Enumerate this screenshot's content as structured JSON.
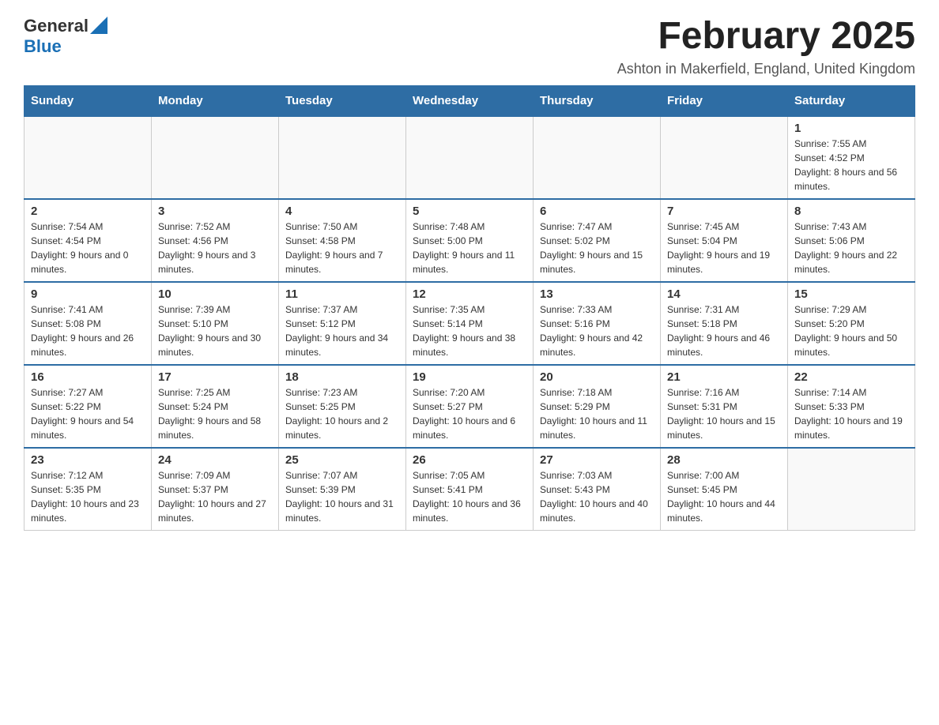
{
  "header": {
    "title": "February 2025",
    "subtitle": "Ashton in Makerfield, England, United Kingdom",
    "logo_general": "General",
    "logo_blue": "Blue"
  },
  "days_of_week": [
    "Sunday",
    "Monday",
    "Tuesday",
    "Wednesday",
    "Thursday",
    "Friday",
    "Saturday"
  ],
  "weeks": [
    [
      {
        "day": "",
        "info": ""
      },
      {
        "day": "",
        "info": ""
      },
      {
        "day": "",
        "info": ""
      },
      {
        "day": "",
        "info": ""
      },
      {
        "day": "",
        "info": ""
      },
      {
        "day": "",
        "info": ""
      },
      {
        "day": "1",
        "info": "Sunrise: 7:55 AM\nSunset: 4:52 PM\nDaylight: 8 hours and 56 minutes."
      }
    ],
    [
      {
        "day": "2",
        "info": "Sunrise: 7:54 AM\nSunset: 4:54 PM\nDaylight: 9 hours and 0 minutes."
      },
      {
        "day": "3",
        "info": "Sunrise: 7:52 AM\nSunset: 4:56 PM\nDaylight: 9 hours and 3 minutes."
      },
      {
        "day": "4",
        "info": "Sunrise: 7:50 AM\nSunset: 4:58 PM\nDaylight: 9 hours and 7 minutes."
      },
      {
        "day": "5",
        "info": "Sunrise: 7:48 AM\nSunset: 5:00 PM\nDaylight: 9 hours and 11 minutes."
      },
      {
        "day": "6",
        "info": "Sunrise: 7:47 AM\nSunset: 5:02 PM\nDaylight: 9 hours and 15 minutes."
      },
      {
        "day": "7",
        "info": "Sunrise: 7:45 AM\nSunset: 5:04 PM\nDaylight: 9 hours and 19 minutes."
      },
      {
        "day": "8",
        "info": "Sunrise: 7:43 AM\nSunset: 5:06 PM\nDaylight: 9 hours and 22 minutes."
      }
    ],
    [
      {
        "day": "9",
        "info": "Sunrise: 7:41 AM\nSunset: 5:08 PM\nDaylight: 9 hours and 26 minutes."
      },
      {
        "day": "10",
        "info": "Sunrise: 7:39 AM\nSunset: 5:10 PM\nDaylight: 9 hours and 30 minutes."
      },
      {
        "day": "11",
        "info": "Sunrise: 7:37 AM\nSunset: 5:12 PM\nDaylight: 9 hours and 34 minutes."
      },
      {
        "day": "12",
        "info": "Sunrise: 7:35 AM\nSunset: 5:14 PM\nDaylight: 9 hours and 38 minutes."
      },
      {
        "day": "13",
        "info": "Sunrise: 7:33 AM\nSunset: 5:16 PM\nDaylight: 9 hours and 42 minutes."
      },
      {
        "day": "14",
        "info": "Sunrise: 7:31 AM\nSunset: 5:18 PM\nDaylight: 9 hours and 46 minutes."
      },
      {
        "day": "15",
        "info": "Sunrise: 7:29 AM\nSunset: 5:20 PM\nDaylight: 9 hours and 50 minutes."
      }
    ],
    [
      {
        "day": "16",
        "info": "Sunrise: 7:27 AM\nSunset: 5:22 PM\nDaylight: 9 hours and 54 minutes."
      },
      {
        "day": "17",
        "info": "Sunrise: 7:25 AM\nSunset: 5:24 PM\nDaylight: 9 hours and 58 minutes."
      },
      {
        "day": "18",
        "info": "Sunrise: 7:23 AM\nSunset: 5:25 PM\nDaylight: 10 hours and 2 minutes."
      },
      {
        "day": "19",
        "info": "Sunrise: 7:20 AM\nSunset: 5:27 PM\nDaylight: 10 hours and 6 minutes."
      },
      {
        "day": "20",
        "info": "Sunrise: 7:18 AM\nSunset: 5:29 PM\nDaylight: 10 hours and 11 minutes."
      },
      {
        "day": "21",
        "info": "Sunrise: 7:16 AM\nSunset: 5:31 PM\nDaylight: 10 hours and 15 minutes."
      },
      {
        "day": "22",
        "info": "Sunrise: 7:14 AM\nSunset: 5:33 PM\nDaylight: 10 hours and 19 minutes."
      }
    ],
    [
      {
        "day": "23",
        "info": "Sunrise: 7:12 AM\nSunset: 5:35 PM\nDaylight: 10 hours and 23 minutes."
      },
      {
        "day": "24",
        "info": "Sunrise: 7:09 AM\nSunset: 5:37 PM\nDaylight: 10 hours and 27 minutes."
      },
      {
        "day": "25",
        "info": "Sunrise: 7:07 AM\nSunset: 5:39 PM\nDaylight: 10 hours and 31 minutes."
      },
      {
        "day": "26",
        "info": "Sunrise: 7:05 AM\nSunset: 5:41 PM\nDaylight: 10 hours and 36 minutes."
      },
      {
        "day": "27",
        "info": "Sunrise: 7:03 AM\nSunset: 5:43 PM\nDaylight: 10 hours and 40 minutes."
      },
      {
        "day": "28",
        "info": "Sunrise: 7:00 AM\nSunset: 5:45 PM\nDaylight: 10 hours and 44 minutes."
      },
      {
        "day": "",
        "info": ""
      }
    ]
  ]
}
